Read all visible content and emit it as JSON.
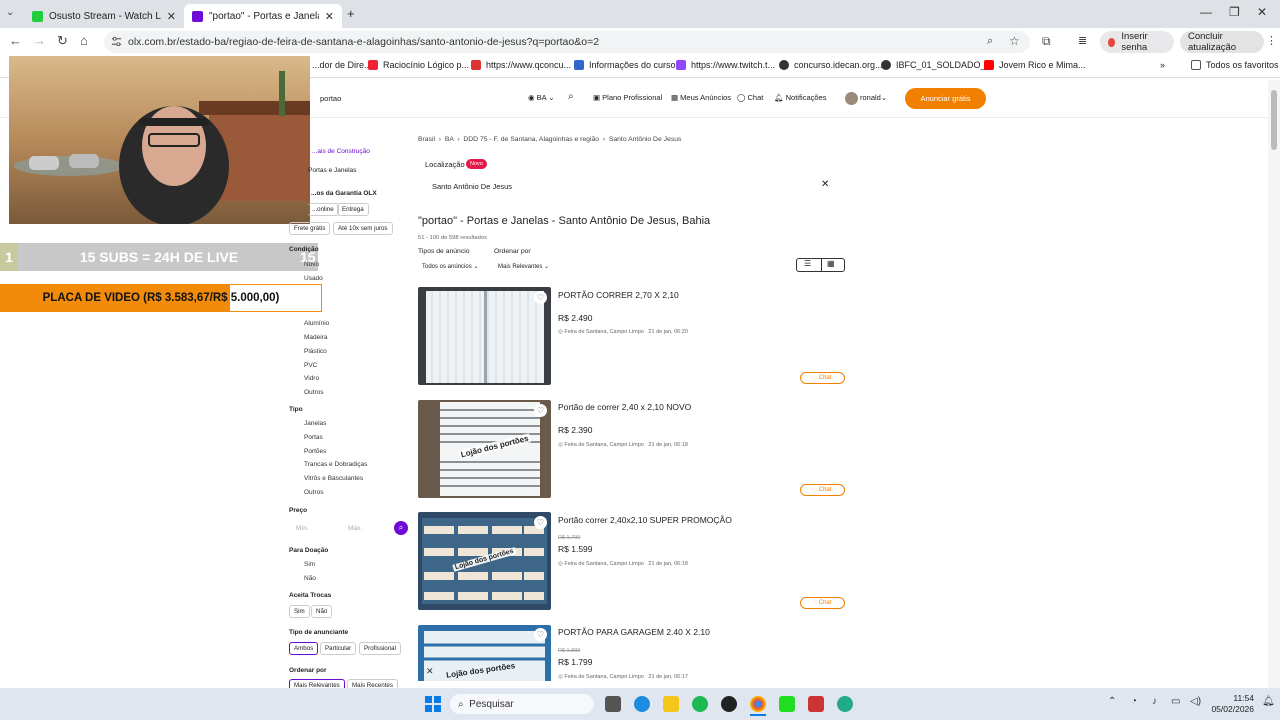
{
  "browser": {
    "tabs": [
      {
        "title": "Osusto Stream - Watch Live on",
        "active": false
      },
      {
        "title": "\"portao\" - Portas e Janelas - Sa",
        "active": true
      }
    ],
    "new_tab": "+",
    "url": "olx.com.br/estado-ba/regiao-de-feira-de-santana-e-alagoinhas/santo-antonio-de-jesus?q=portao&o=2",
    "inserir_senha": "Inserir senha",
    "concluir": "Concluir atualização",
    "bookmarks": [
      "...dor de Dire...",
      "Raciocínio Lógico p...",
      "https://www.qconcu...",
      "Informações do curso",
      "https://www.twitch.t...",
      "concurso.idecan.org...",
      "IBFC_01_SOLDADO_...",
      "Jovem Rico e Mima...",
      "Todos os favoritos"
    ]
  },
  "olx_header": {
    "search": "portao",
    "state": "BA",
    "plano": "Plano Profissional",
    "meus_anuncios": "Meus Anúncios",
    "chat": "Chat",
    "notificacoes": "Notificações",
    "user": "ronald",
    "anunciar": "Anunciar grátis"
  },
  "stream": {
    "subs_count": "1",
    "subs_goal_text": "15 SUBS = 24H DE LIVE",
    "subs_goal": "15",
    "donation_text": "PLACA DE VIDEO (R$ 3.583,67/R$ 5.000,00)",
    "donation_progress": 0.7167
  },
  "sidebar": {
    "categoria_link": "...ais de Construção",
    "categoria": "Portas e Janelas",
    "garantia": "...os da Garantia OLX",
    "garantia_chips": [
      "...online",
      "Entrega"
    ],
    "pagamento_chips": [
      "Frete grátis",
      "Até 10x sem juros"
    ],
    "condicao_title": "Condição",
    "condicao": [
      "Novo",
      "Usado"
    ],
    "material": [
      "Alumínio",
      "Madeira",
      "Plástico",
      "PVC",
      "Vidro",
      "Outros"
    ],
    "tipo_title": "Tipo",
    "tipo": [
      "Janelas",
      "Portas",
      "Portões",
      "Trancas e Dobradiças",
      "Vitrôs e Basculantes",
      "Outros"
    ],
    "preco_title": "Preço",
    "preco_min": "Mín.",
    "preco_max": "Máx.",
    "doacao_title": "Para Doação",
    "doacao": [
      "Sim",
      "Não"
    ],
    "trocas_title": "Aceita Trocas",
    "trocas": [
      "Sim",
      "Não"
    ],
    "anunciante_title": "Tipo de anunciante",
    "anunciante": [
      "Ambos",
      "Particular",
      "Profissional"
    ],
    "ordenar_title": "Ordenar por",
    "ordenar": [
      "Mais Relevantes",
      "Mais Recentes"
    ]
  },
  "main": {
    "breadcrumb": [
      "Brasil",
      "BA",
      "DDD 75 - F. de Santana, Alagoinhas e região",
      "Santo Antônio De Jesus"
    ],
    "localizacao_label": "Localização",
    "novo_badge": "Novo",
    "location_value": "Santo Antônio De Jesus",
    "heading": "\"portao\" - Portas e Janelas - Santo Antônio De Jesus, Bahia",
    "results": "51 - 100 de 598 resultados",
    "tipos_label": "Tipos de anúncio",
    "tipos_value": "Todos os anúncios",
    "ordenar_label": "Ordenar por",
    "ordenar_value": "Mais Relevantes",
    "listings": [
      {
        "title": "PORTÃO CORRER 2,70 X 2,10",
        "old_price": "",
        "price": "R$ 2.490",
        "location": "Feira de Santana, Campo Limpo",
        "date": "21 de jan, 06:20",
        "overlay": "",
        "chat": "Chat"
      },
      {
        "title": "Portão de correr 2,40 x 2,10 NOVO",
        "old_price": "",
        "price": "R$ 2.390",
        "location": "Feira de Santana, Campo Limpo",
        "date": "21 de jan, 06:18",
        "overlay": "Lojão dos portões",
        "chat": "Chat"
      },
      {
        "title": "Portão correr 2,40x2,10 SUPER PROMOÇÃO",
        "old_price": "R$ 1.799",
        "price": "R$ 1.599",
        "location": "Feira de Santana, Campo Limpo",
        "date": "21 de jan, 06:18",
        "overlay": "Lojão dos portões",
        "chat": "Chat"
      },
      {
        "title": "PORTÃO PARA GARAGEM 2.40 X 2.10",
        "old_price": "R$ 1.899",
        "price": "R$ 1.799",
        "location": "Feira de Santana, Campo Limpo",
        "date": "21 de jan, 06:17",
        "overlay": "Lojão dos portões",
        "chat": ""
      }
    ]
  },
  "taskbar": {
    "search": "Pesquisar",
    "time": "11:54",
    "date": "05/02/2026"
  },
  "colors": {
    "olx_orange": "#f28000",
    "olx_purple": "#6e0ad6",
    "donation_orange": "#f28a0a"
  }
}
